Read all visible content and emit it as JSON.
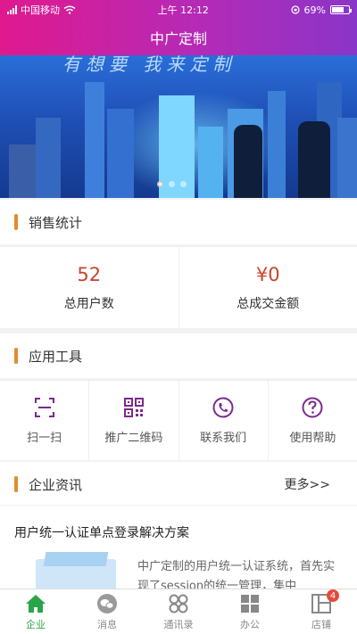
{
  "status_bar": {
    "carrier": "中国移动",
    "time": "上午 12:12",
    "battery": "69%"
  },
  "nav": {
    "title": "中广定制"
  },
  "banner": {
    "headline": "有想要 我来定制",
    "active_index": 0,
    "count": 3
  },
  "sales": {
    "section_title": "销售统计",
    "stats": [
      {
        "value": "52",
        "label": "总用户数"
      },
      {
        "value": "¥0",
        "label": "总成交金额"
      }
    ]
  },
  "tools": {
    "section_title": "应用工具",
    "items": [
      {
        "label": "扫一扫",
        "icon": "scan-icon"
      },
      {
        "label": "推广二维码",
        "icon": "qrcode-icon"
      },
      {
        "label": "联系我们",
        "icon": "phone-icon"
      },
      {
        "label": "使用帮助",
        "icon": "help-icon"
      }
    ]
  },
  "news": {
    "section_title": "企业资讯",
    "more_label": "更多>>",
    "headline": "用户统一认证单点登录解决方案",
    "summary": "中广定制的用户统一认证系统，首先实现了session的统一管理，集中"
  },
  "tabbar": {
    "items": [
      {
        "label": "企业",
        "icon": "home-icon",
        "active": true
      },
      {
        "label": "消息",
        "icon": "message-icon"
      },
      {
        "label": "通讯录",
        "icon": "contacts-icon"
      },
      {
        "label": "办公",
        "icon": "office-icon"
      },
      {
        "label": "店铺",
        "icon": "shop-icon",
        "badge": "4"
      }
    ]
  },
  "colors": {
    "accent_purple": "#7a2a8c",
    "value_red": "#c8432e",
    "section_bar": "#e38a2d",
    "tab_active": "#2aa54a"
  }
}
